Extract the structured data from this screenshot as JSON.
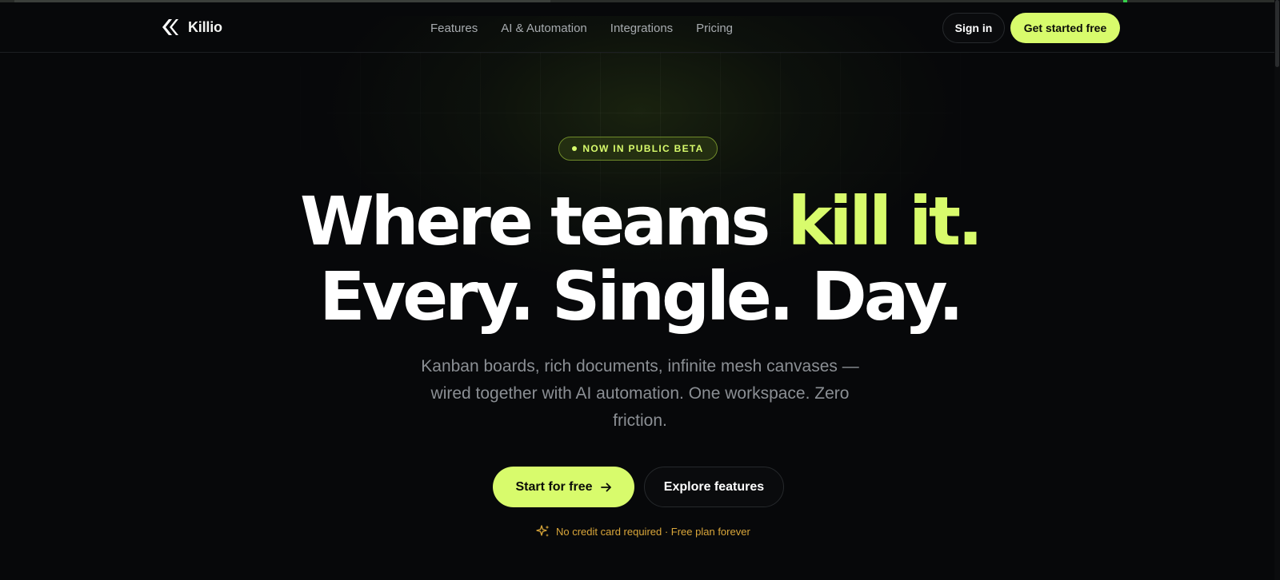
{
  "header": {
    "brand": "Killio",
    "nav": [
      "Features",
      "AI & Automation",
      "Integrations",
      "Pricing"
    ],
    "sign_in_label": "Sign in",
    "get_started_label": "Get started free"
  },
  "hero": {
    "badge": "NOW IN PUBLIC BETA",
    "headline_line1": "Where teams ",
    "headline_accent": "kill it.",
    "headline_line2": "Every. Single. Day.",
    "subtitle": "Kanban boards, rich documents, infinite mesh canvases — wired together with AI automation. One workspace. Zero friction.",
    "primary_cta": "Start for free",
    "secondary_cta": "Explore features",
    "note": "No credit card required · Free plan forever"
  },
  "icons": {
    "logo": "killio-chevrons-logo-icon",
    "arrow": "arrow-right-icon",
    "sparkle": "sparkles-icon"
  },
  "colors": {
    "background": "#07080a",
    "accent": "#d8fb6c",
    "muted_text": "#8b8f94",
    "note_text": "#d9a63a"
  }
}
